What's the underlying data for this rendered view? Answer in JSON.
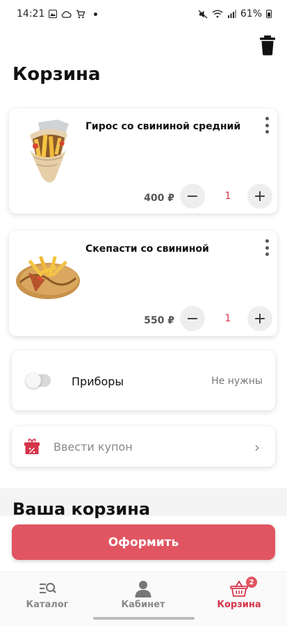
{
  "status": {
    "time": "14:21",
    "battery": "61%"
  },
  "page": {
    "title": "Корзина"
  },
  "cart": {
    "items": [
      {
        "name": "Гирос со свининой средний",
        "price": "400 ₽",
        "qty": "1",
        "minus": "−",
        "plus": "+"
      },
      {
        "name": "Скепасти со свининой",
        "price": "550 ₽",
        "qty": "1",
        "minus": "−",
        "plus": "+"
      }
    ]
  },
  "options": {
    "cutlery": {
      "label": "Приборы",
      "value": "Не нужны",
      "enabled": false
    },
    "coupon": {
      "label": "Ввести купон",
      "chevron": "›"
    }
  },
  "summary": {
    "title": "Ваша корзина"
  },
  "checkout": {
    "label": "Оформить"
  },
  "nav": {
    "items": [
      {
        "label": "Каталог",
        "icon": "catalog-search-icon"
      },
      {
        "label": "Кабинет",
        "icon": "person-icon"
      },
      {
        "label": "Корзина",
        "icon": "basket-icon",
        "badge": "2",
        "active": true
      }
    ]
  },
  "colors": {
    "accent": "#e05561",
    "accent_text": "#d5344a"
  }
}
